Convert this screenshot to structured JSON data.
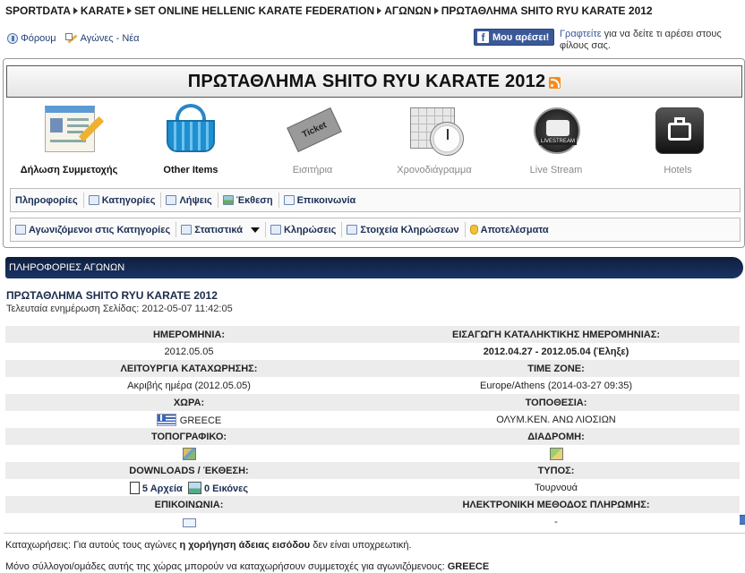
{
  "breadcrumb": [
    "SPORTDATA",
    "KARATE",
    "SET ONLINE HELLENIC KARATE FEDERATION",
    "ΑΓΩΝΩΝ",
    "ΠΡΩΤΑΘΛΗΜΑ SHITO RYU KARATE 2012"
  ],
  "toplinks": {
    "forum": "Φόρουμ",
    "news": "Αγώνες - Νέα"
  },
  "facebook": {
    "button": "Μου αρέσει!",
    "link": "Γραφτείτε",
    "text": " για να δείτε τι αρέσει στους φίλους σας."
  },
  "title": "ΠΡΩΤΑΘΛΗΜΑ SHITO RYU KARATE 2012",
  "icons": [
    {
      "label": "Δήλωση Συμμετοχής",
      "icon": "registration-form-icon",
      "active": true
    },
    {
      "label": "Other Items",
      "icon": "basket-icon",
      "active": true
    },
    {
      "label": "Εισιτήρια",
      "icon": "ticket-icon",
      "active": false
    },
    {
      "label": "Χρονοδιάγραμμα",
      "icon": "schedule-clock-icon",
      "active": false
    },
    {
      "label": "Live Stream",
      "icon": "livestream-tv-icon",
      "active": false
    },
    {
      "label": "Hotels",
      "icon": "suitcase-icon",
      "active": false
    }
  ],
  "menu1": [
    "Πληροφορίες",
    "Κατηγορίες",
    "Λήψεις",
    "Έκθεση",
    "Επικοινωνία"
  ],
  "menu2": [
    "Αγωνιζόμενοι στις Κατηγορίες",
    "Στατιστικά",
    "Κληρώσεις",
    "Στοιχεία Κληρώσεων",
    "Αποτελέσματα"
  ],
  "section_title": "ΠΛΗΡΟΦΟΡΙΕΣ ΑΓΩΝΩΝ",
  "event": {
    "name": "ΠΡΩΤΑΘΛΗΜΑ SHITO RYU KARATE 2012",
    "updated": "Τελευταία ενημέρωση Σελίδας: 2012-05-07 11:42:05"
  },
  "info": {
    "date_label": "ΗΜΕΡΟΜΗΝΙΑ:",
    "date_value": "2012.05.05",
    "deadline_label": "ΕΙΣΑΓΩΓΗ ΚΑΤΑΛΗΚΤΙΚΗΣ ΗΜΕΡΟΜΗΝΙΑΣ:",
    "deadline_value": "2012.04.27 - 2012.05.04 (Έληξε)",
    "mode_label": "ΛΕΙΤΟΥΡΓΙΑ ΚΑΤΑΧΩΡΗΣΗΣ:",
    "mode_value": "Ακριβής ημέρα (2012.05.05)",
    "tz_label": "TIME ZONE:",
    "tz_value": "Europe/Athens (2014-03-27 09:35)",
    "country_label": "ΧΩΡΑ:",
    "country_value": "GREECE",
    "location_label": "ΤΟΠΟΘΕΣΙΑ:",
    "location_value": "ΟΛΥΜ.ΚΕΝ. ΑΝΩ ΛΙΟΣΙΩΝ",
    "topo_label": "ΤΟΠΟΓΡΑΦΙΚΟ:",
    "route_label": "ΔΙΑΔΡΟΜΗ:",
    "downloads_label": "DOWNLOADS / ΈΚΘΕΣΗ:",
    "files_value": "5 Αρχεία",
    "images_value": "0 Εικόνες",
    "type_label": "ΤΥΠΟΣ:",
    "type_value": "Τουρνουά",
    "contact_label": "ΕΠΙΚΟΙΝΩΝΙΑ:",
    "payment_label": "ΗΛΕΚΤΡΟΝΙΚΗ ΜΕΘΟΔΟΣ ΠΛΗΡΩΜΗΣ:",
    "payment_value": "-"
  },
  "note1": {
    "pre": "Καταχωρήσεις: Για αυτούς τους αγώνες ",
    "bold": "η χορήγηση άδειας εισόδου",
    "post": " δεν είναι υποχρεωτική."
  },
  "note2": {
    "pre": "Μόνο σύλλογοι/ομάδες αυτής της χώρας μπορούν να καταχωρήσουν συμμετοχές για αγωνιζόμενους: ",
    "bold": "GREECE"
  },
  "colors": {
    "header_bg": "#0f1e3d",
    "deadline_red": "#b02020",
    "facebook": "#3b5998"
  }
}
